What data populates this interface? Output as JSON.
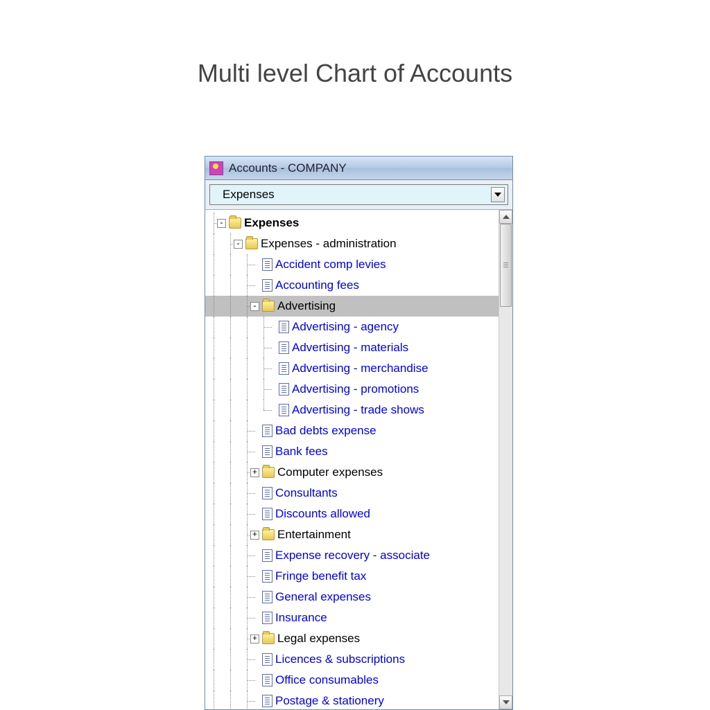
{
  "page_title": "Multi level Chart of Accounts",
  "window_title": "Accounts - COMPANY",
  "dropdown_value": "Expenses",
  "tree": [
    {
      "depth": 0,
      "kind": "folder",
      "label": "Expenses",
      "bold": true,
      "expander": "-",
      "lines": [],
      "conn": "tee"
    },
    {
      "depth": 1,
      "kind": "folder",
      "label": "Expenses - administration",
      "expander": "-",
      "lines": [
        "vert"
      ],
      "conn": "tee"
    },
    {
      "depth": 2,
      "kind": "doc",
      "label": "Accident comp levies",
      "link": true,
      "lines": [
        "vert",
        "vert"
      ],
      "conn": "tee"
    },
    {
      "depth": 2,
      "kind": "doc",
      "label": "Accounting fees",
      "link": true,
      "lines": [
        "vert",
        "vert"
      ],
      "conn": "tee"
    },
    {
      "depth": 2,
      "kind": "folder",
      "label": "Advertising",
      "selected": true,
      "expander": "-",
      "lines": [
        "vert",
        "vert"
      ],
      "conn": "tee"
    },
    {
      "depth": 3,
      "kind": "doc",
      "label": "Advertising - agency",
      "link": true,
      "lines": [
        "vert",
        "vert",
        "vert"
      ],
      "conn": "tee"
    },
    {
      "depth": 3,
      "kind": "doc",
      "label": "Advertising - materials",
      "link": true,
      "lines": [
        "vert",
        "vert",
        "vert"
      ],
      "conn": "tee"
    },
    {
      "depth": 3,
      "kind": "doc",
      "label": "Advertising - merchandise",
      "link": true,
      "lines": [
        "vert",
        "vert",
        "vert"
      ],
      "conn": "tee"
    },
    {
      "depth": 3,
      "kind": "doc",
      "label": "Advertising - promotions",
      "link": true,
      "lines": [
        "vert",
        "vert",
        "vert"
      ],
      "conn": "tee"
    },
    {
      "depth": 3,
      "kind": "doc",
      "label": "Advertising - trade shows",
      "link": true,
      "lines": [
        "vert",
        "vert",
        "vert"
      ],
      "conn": "elbow"
    },
    {
      "depth": 2,
      "kind": "doc",
      "label": "Bad debts expense",
      "link": true,
      "lines": [
        "vert",
        "vert"
      ],
      "conn": "tee"
    },
    {
      "depth": 2,
      "kind": "doc",
      "label": "Bank fees",
      "link": true,
      "lines": [
        "vert",
        "vert"
      ],
      "conn": "tee"
    },
    {
      "depth": 2,
      "kind": "folder",
      "label": "Computer expenses",
      "expander": "+",
      "lines": [
        "vert",
        "vert"
      ],
      "conn": "tee"
    },
    {
      "depth": 2,
      "kind": "doc",
      "label": "Consultants",
      "link": true,
      "lines": [
        "vert",
        "vert"
      ],
      "conn": "tee"
    },
    {
      "depth": 2,
      "kind": "doc",
      "label": "Discounts allowed",
      "link": true,
      "lines": [
        "vert",
        "vert"
      ],
      "conn": "tee"
    },
    {
      "depth": 2,
      "kind": "folder",
      "label": "Entertainment",
      "expander": "+",
      "lines": [
        "vert",
        "vert"
      ],
      "conn": "tee"
    },
    {
      "depth": 2,
      "kind": "doc",
      "label": "Expense recovery - associate",
      "link": true,
      "lines": [
        "vert",
        "vert"
      ],
      "conn": "tee"
    },
    {
      "depth": 2,
      "kind": "doc",
      "label": "Fringe benefit tax",
      "link": true,
      "lines": [
        "vert",
        "vert"
      ],
      "conn": "tee"
    },
    {
      "depth": 2,
      "kind": "doc",
      "label": "General expenses",
      "link": true,
      "lines": [
        "vert",
        "vert"
      ],
      "conn": "tee"
    },
    {
      "depth": 2,
      "kind": "doc",
      "label": "Insurance",
      "link": true,
      "lines": [
        "vert",
        "vert"
      ],
      "conn": "tee"
    },
    {
      "depth": 2,
      "kind": "folder",
      "label": "Legal expenses",
      "expander": "+",
      "lines": [
        "vert",
        "vert"
      ],
      "conn": "tee"
    },
    {
      "depth": 2,
      "kind": "doc",
      "label": "Licences & subscriptions",
      "link": true,
      "lines": [
        "vert",
        "vert"
      ],
      "conn": "tee"
    },
    {
      "depth": 2,
      "kind": "doc",
      "label": "Office consumables",
      "link": true,
      "lines": [
        "vert",
        "vert"
      ],
      "conn": "tee"
    },
    {
      "depth": 2,
      "kind": "doc",
      "label": "Postage & stationery",
      "link": true,
      "lines": [
        "vert",
        "vert"
      ],
      "conn": "tee"
    }
  ]
}
